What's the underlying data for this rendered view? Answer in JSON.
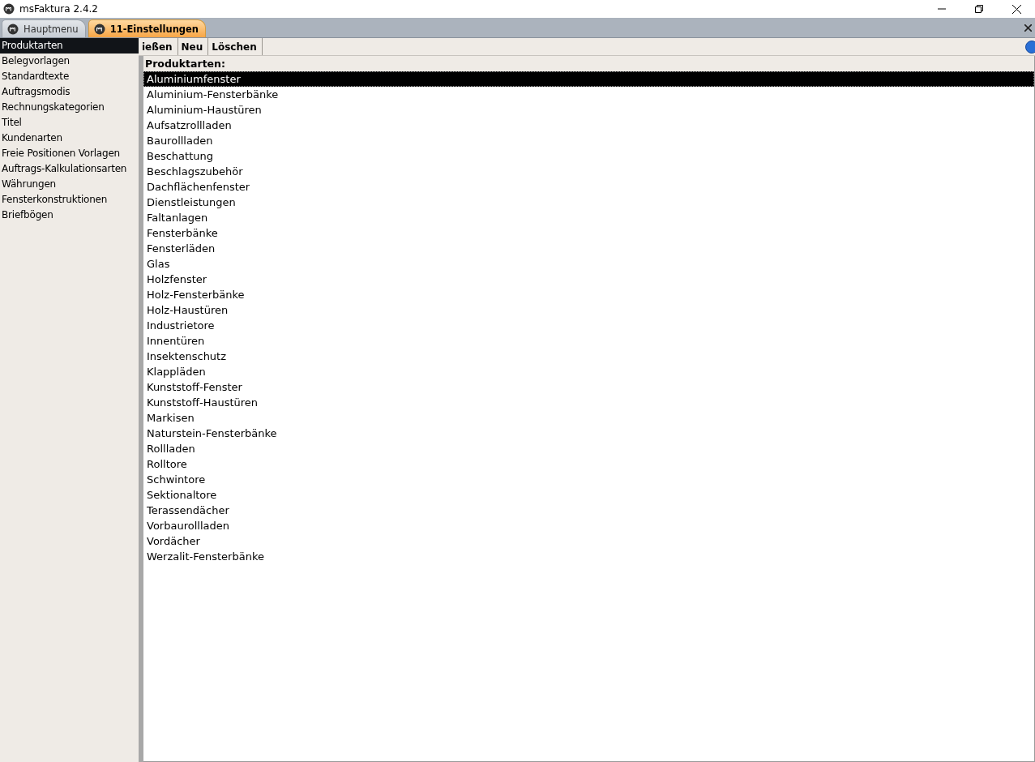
{
  "window": {
    "title": "msFaktura 2.4.2"
  },
  "tabs": [
    {
      "label": "Hauptmenu",
      "selected": false
    },
    {
      "label": "11-Einstellungen",
      "selected": true
    }
  ],
  "sidebar": {
    "items": [
      {
        "label": "Produktarten",
        "selected": true
      },
      {
        "label": "Belegvorlagen",
        "selected": false
      },
      {
        "label": "Standardtexte",
        "selected": false
      },
      {
        "label": "Auftragsmodis",
        "selected": false
      },
      {
        "label": "Rechnungskategorien",
        "selected": false
      },
      {
        "label": "Titel",
        "selected": false
      },
      {
        "label": "Kundenarten",
        "selected": false
      },
      {
        "label": "Freie Positionen Vorlagen",
        "selected": false
      },
      {
        "label": "Auftrags-Kalkulationsarten",
        "selected": false
      },
      {
        "label": "Währungen",
        "selected": false
      },
      {
        "label": "Fensterkonstruktionen",
        "selected": false
      },
      {
        "label": "Briefbögen",
        "selected": false
      }
    ]
  },
  "toolbar": {
    "buttons": [
      "ießen",
      "Neu",
      "Löschen"
    ]
  },
  "list": {
    "title": "Produktarten:",
    "items": [
      {
        "label": "Aluminiumfenster",
        "selected": true
      },
      {
        "label": "Aluminium-Fensterbänke",
        "selected": false
      },
      {
        "label": "Aluminium-Haustüren",
        "selected": false
      },
      {
        "label": "Aufsatzrollladen",
        "selected": false
      },
      {
        "label": "Baurollladen",
        "selected": false
      },
      {
        "label": "Beschattung",
        "selected": false
      },
      {
        "label": "Beschlagszubehör",
        "selected": false
      },
      {
        "label": "Dachflächenfenster",
        "selected": false
      },
      {
        "label": "Dienstleistungen",
        "selected": false
      },
      {
        "label": "Faltanlagen",
        "selected": false
      },
      {
        "label": "Fensterbänke",
        "selected": false
      },
      {
        "label": "Fensterläden",
        "selected": false
      },
      {
        "label": "Glas",
        "selected": false
      },
      {
        "label": "Holzfenster",
        "selected": false
      },
      {
        "label": "Holz-Fensterbänke",
        "selected": false
      },
      {
        "label": "Holz-Haustüren",
        "selected": false
      },
      {
        "label": "Industrietore",
        "selected": false
      },
      {
        "label": "Innentüren",
        "selected": false
      },
      {
        "label": "Insektenschutz",
        "selected": false
      },
      {
        "label": "Klappläden",
        "selected": false
      },
      {
        "label": "Kunststoff-Fenster",
        "selected": false
      },
      {
        "label": "Kunststoff-Haustüren",
        "selected": false
      },
      {
        "label": "Markisen",
        "selected": false
      },
      {
        "label": "Naturstein-Fensterbänke",
        "selected": false
      },
      {
        "label": "Rollladen",
        "selected": false
      },
      {
        "label": "Rolltore",
        "selected": false
      },
      {
        "label": "Schwintore",
        "selected": false
      },
      {
        "label": "Sektionaltore",
        "selected": false
      },
      {
        "label": "Terassendächer",
        "selected": false
      },
      {
        "label": "Vorbaurollladen",
        "selected": false
      },
      {
        "label": "Vordächer",
        "selected": false
      },
      {
        "label": "Werzalit-Fensterbänke",
        "selected": false
      }
    ]
  }
}
